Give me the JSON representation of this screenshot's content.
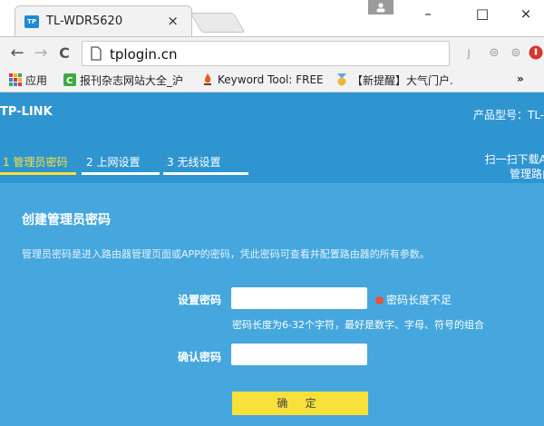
{
  "browser": {
    "tab": {
      "favicon": "TP",
      "title": "TL-WDR5620",
      "close": "×"
    },
    "window_controls": {
      "minimize": "–",
      "maximize": "□",
      "close": "×"
    },
    "nav": {
      "back": "←",
      "forward": "→",
      "reload": "C"
    },
    "address": "tplogin.cn",
    "bookmarks": [
      {
        "label": "应用",
        "icon": "apps-grid-icon",
        "color": "#e3352c"
      },
      {
        "label": "报刊杂志网站大全_沪",
        "icon": "bookmark-c-icon",
        "color": "#3ea944"
      },
      {
        "label": "Keyword Tool: FREE",
        "icon": "flame-icon",
        "color": "#e85e1c"
      },
      {
        "label": "【新提醒】大气门户.",
        "icon": "medal-icon",
        "color": "#f0b63a"
      }
    ],
    "bookmarks_overflow": "»"
  },
  "router": {
    "logo": "TP-LINK",
    "model_prefix": "产品型号：TL-",
    "steps": [
      {
        "label": "1 管理员密码",
        "active": true
      },
      {
        "label": "2 上网设置",
        "active": false
      },
      {
        "label": "3 无线设置",
        "active": false
      }
    ],
    "scan_line1": "扫一扫下载AP",
    "scan_line2": "管理路由",
    "panel": {
      "title": "创建管理员密码",
      "description": "管理员密码是进入路由器管理页面或APP的密码，凭此密码可查看并配置路由器的所有参数。",
      "password_label": "设置密码",
      "password_value": "",
      "error": "密码长度不足",
      "hint": "密码长度为6-32个字符，最好是数字、字母、符号的组合",
      "confirm_label": "确认密码",
      "confirm_value": "",
      "submit": "确 定"
    },
    "colors": {
      "header": "#2f95d1",
      "panel": "#45a7dd",
      "accent": "#f7e03a",
      "error": "#e4553b"
    }
  }
}
